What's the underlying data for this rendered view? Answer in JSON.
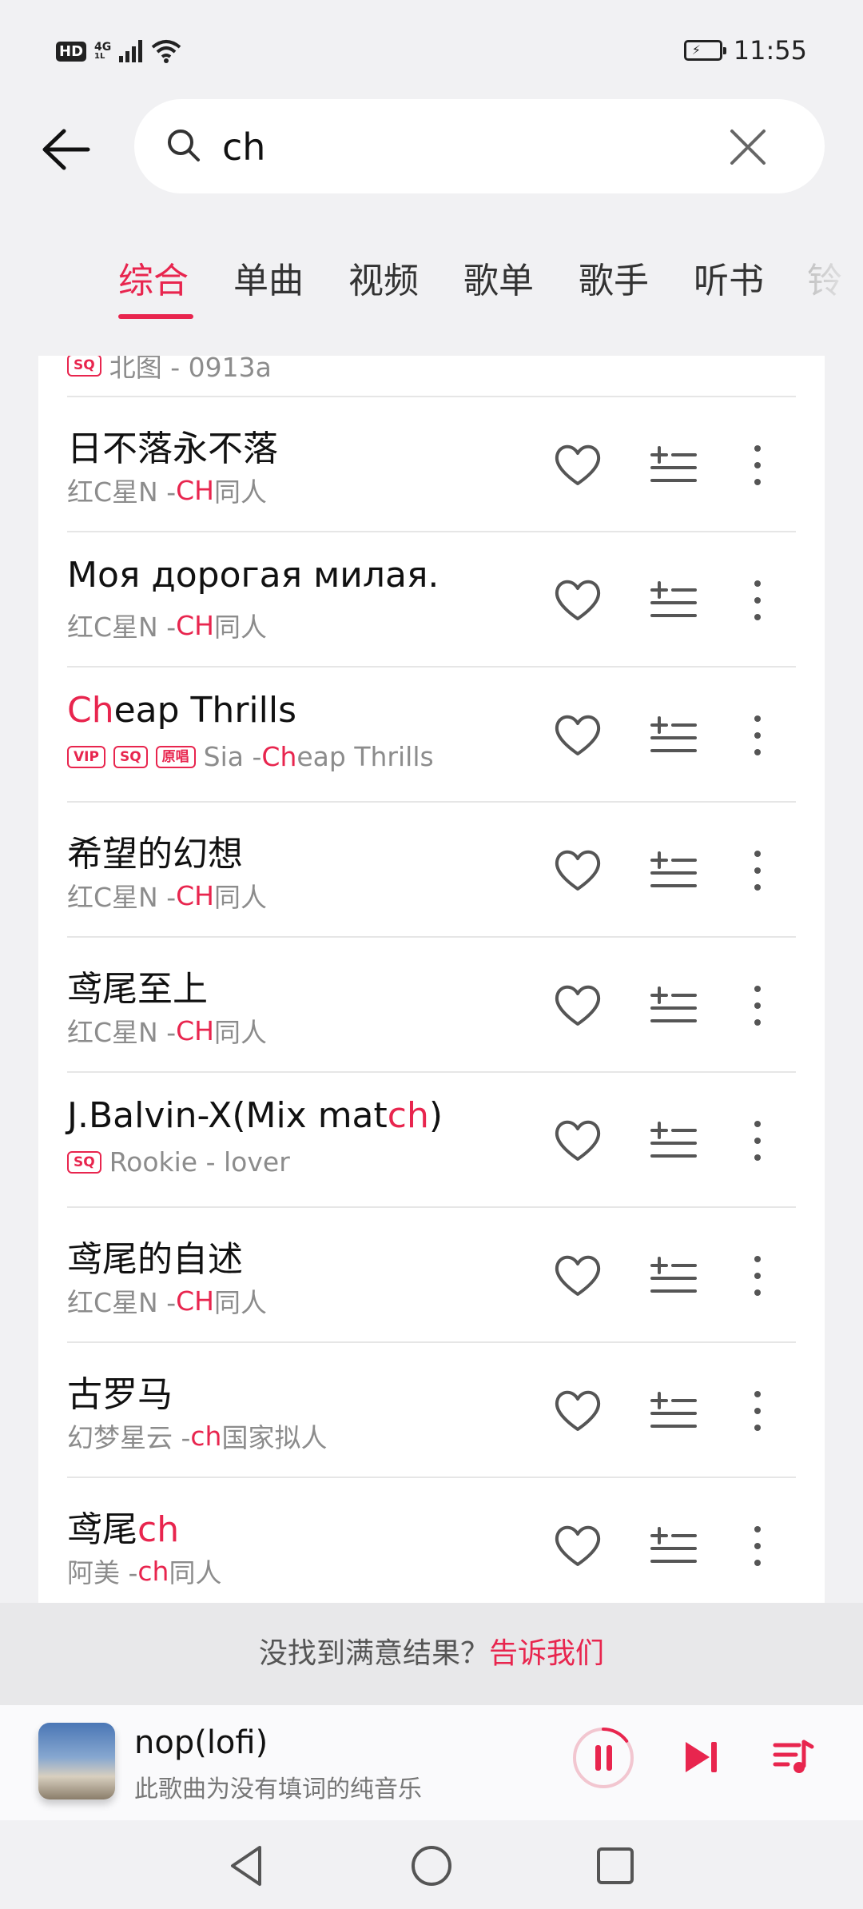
{
  "status_bar": {
    "hd": "HD",
    "network": "4G",
    "network_sub": "1L",
    "time": "11:55"
  },
  "search": {
    "query": "ch",
    "icon": "search-icon",
    "clear_icon": "close-icon"
  },
  "tabs": [
    "综合",
    "单曲",
    "视频",
    "歌单",
    "歌手",
    "听书",
    "铃"
  ],
  "active_tab": "综合",
  "partial_row": {
    "tag": "SQ",
    "subtitle": "北图 - 0913a"
  },
  "songs": [
    {
      "title": [
        {
          "t": "日不落永不落",
          "h": false
        }
      ],
      "tags": [],
      "subtitle": [
        {
          "t": "红C星N - ",
          "h": false
        },
        {
          "t": "CH",
          "h": true
        },
        {
          "t": "同人",
          "h": false
        }
      ]
    },
    {
      "title": [
        {
          "t": "Моя дорогая милая.",
          "h": false
        }
      ],
      "tags": [],
      "subtitle": [
        {
          "t": "红C星N - ",
          "h": false
        },
        {
          "t": "CH",
          "h": true
        },
        {
          "t": "同人",
          "h": false
        }
      ]
    },
    {
      "title": [
        {
          "t": "Ch",
          "h": true
        },
        {
          "t": "eap Thrills",
          "h": false
        }
      ],
      "tags": [
        "VIP",
        "SQ",
        "原唱"
      ],
      "subtitle": [
        {
          "t": "Sia - ",
          "h": false
        },
        {
          "t": "Ch",
          "h": true
        },
        {
          "t": "eap Thrills",
          "h": false
        }
      ]
    },
    {
      "title": [
        {
          "t": "希望的幻想",
          "h": false
        }
      ],
      "tags": [],
      "subtitle": [
        {
          "t": "红C星N - ",
          "h": false
        },
        {
          "t": "CH",
          "h": true
        },
        {
          "t": "同人",
          "h": false
        }
      ]
    },
    {
      "title": [
        {
          "t": "鸢尾至上",
          "h": false
        }
      ],
      "tags": [],
      "subtitle": [
        {
          "t": "红C星N - ",
          "h": false
        },
        {
          "t": "CH",
          "h": true
        },
        {
          "t": "同人",
          "h": false
        }
      ]
    },
    {
      "title": [
        {
          "t": "J.Balvin-X(Mix mat",
          "h": false
        },
        {
          "t": "ch",
          "h": true
        },
        {
          "t": ")",
          "h": false
        }
      ],
      "tags": [
        "SQ"
      ],
      "subtitle": [
        {
          "t": "Rookie - lover",
          "h": false
        }
      ]
    },
    {
      "title": [
        {
          "t": "鸢尾的自述",
          "h": false
        }
      ],
      "tags": [],
      "subtitle": [
        {
          "t": "红C星N - ",
          "h": false
        },
        {
          "t": "CH",
          "h": true
        },
        {
          "t": "同人",
          "h": false
        }
      ]
    },
    {
      "title": [
        {
          "t": "古罗马",
          "h": false
        }
      ],
      "tags": [],
      "subtitle": [
        {
          "t": "幻梦星云 - ",
          "h": false
        },
        {
          "t": "ch",
          "h": true
        },
        {
          "t": "国家拟人",
          "h": false
        }
      ]
    },
    {
      "title": [
        {
          "t": "鸢尾",
          "h": false
        },
        {
          "t": "ch",
          "h": true
        }
      ],
      "tags": [],
      "subtitle": [
        {
          "t": "阿美 - ",
          "h": false
        },
        {
          "t": "ch",
          "h": true
        },
        {
          "t": "同人",
          "h": false
        }
      ]
    }
  ],
  "feedback": {
    "text": "没找到满意结果？",
    "link": "告诉我们"
  },
  "player": {
    "title": "nop(lofi)",
    "subtitle": "此歌曲为没有填词的纯音乐",
    "progress": 0.15
  },
  "colors": {
    "accent": "#e8254e",
    "background": "#f1f1f3",
    "subtitle": "#8c8c8c"
  }
}
